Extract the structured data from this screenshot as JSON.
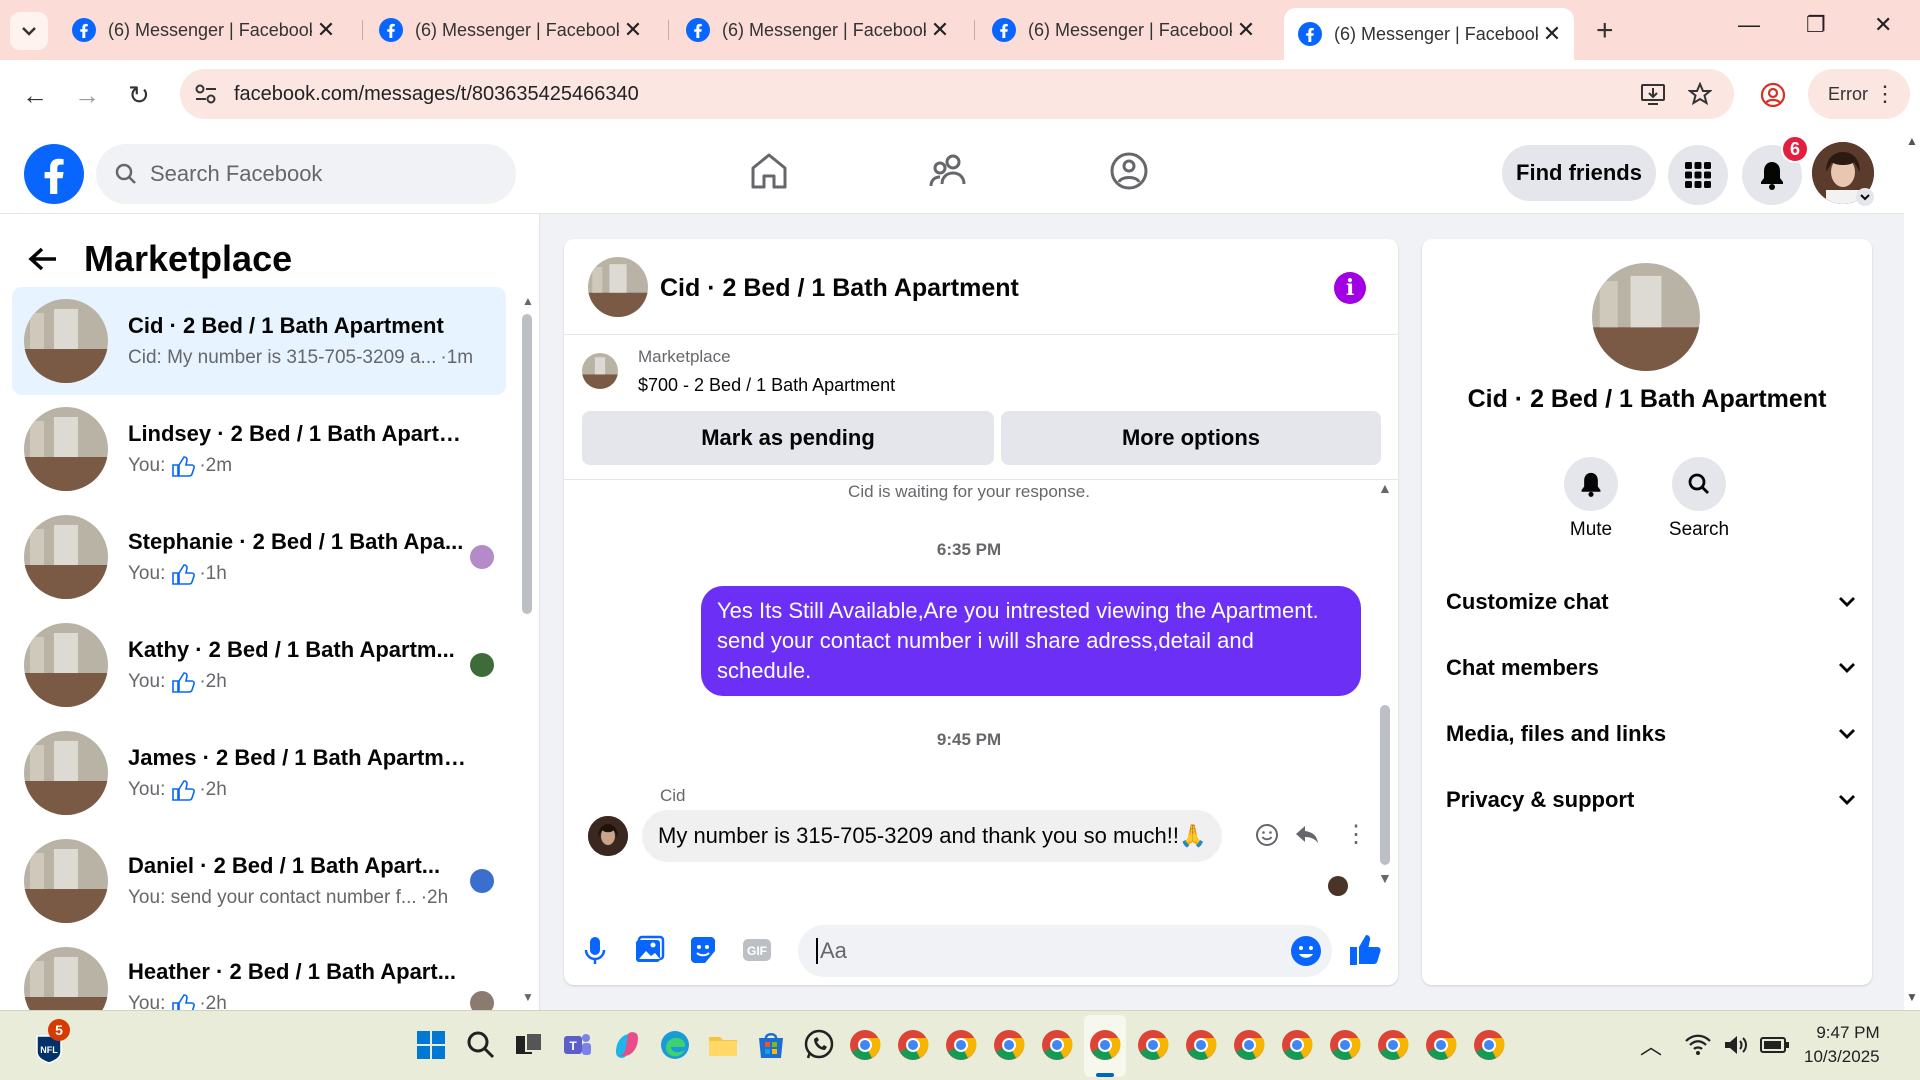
{
  "browser": {
    "tabs": [
      {
        "title": "(6) Messenger | Facebook"
      },
      {
        "title": "(6) Messenger | Facebook"
      },
      {
        "title": "(6) Messenger | Facebook"
      },
      {
        "title": "(6) Messenger | Facebook"
      },
      {
        "title": "(6) Messenger | Facebook"
      }
    ],
    "url": "facebook.com/messages/t/803635425466340",
    "profile_status": "Error"
  },
  "header": {
    "search_placeholder": "Search Facebook",
    "find_friends": "Find friends",
    "notification_count": "6"
  },
  "sidebar": {
    "title": "Marketplace",
    "conversations": [
      {
        "name": "Cid · 2 Bed / 1 Bath Apartment",
        "preview": "Cid: My number is 315-705-3209 a...",
        "time": "·1m"
      },
      {
        "name": "Lindsey · 2 Bed / 1 Bath Apartm...",
        "preview": "You:",
        "time": "·2m"
      },
      {
        "name": "Stephanie · 2 Bed / 1 Bath Apa...",
        "preview": "You:",
        "time": "·1h"
      },
      {
        "name": "Kathy · 2 Bed / 1 Bath Apartm...",
        "preview": "You:",
        "time": "·2h"
      },
      {
        "name": "James · 2 Bed / 1 Bath Apartment",
        "preview": "You:",
        "time": "·2h"
      },
      {
        "name": "Daniel · 2 Bed / 1 Bath Apart...",
        "preview": "You: send your contact number f...",
        "time": "·2h"
      },
      {
        "name": "Heather · 2 Bed / 1 Bath Apart...",
        "preview": "You:",
        "time": "·2h"
      }
    ]
  },
  "chat": {
    "title": "Cid · 2 Bed / 1 Bath Apartment",
    "listing_source": "Marketplace",
    "listing": "$700 - 2 Bed / 1 Bath Apartment",
    "mark_pending": "Mark as pending",
    "more_options": "More options",
    "waiting": "Cid is waiting for your response.",
    "time1": "6:35 PM",
    "outgoing": "Yes Its Still Available,Are you intrested viewing the Apartment. send your contact number i will share adress,detail and schedule.",
    "time2": "9:45 PM",
    "sender": "Cid",
    "incoming": "My number is 315-705-3209 and thank you so much!!🙏",
    "composer_placeholder": "Aa"
  },
  "info_pane": {
    "name": "Cid · 2 Bed / 1 Bath Apartment",
    "mute": "Mute",
    "search": "Search",
    "sections": [
      "Customize chat",
      "Chat members",
      "Media, files and links",
      "Privacy & support"
    ]
  },
  "taskbar": {
    "nfl_badge": "5",
    "time": "9:47 PM",
    "date": "10/3/2025"
  },
  "colors": {
    "facebook_blue": "#0866ff",
    "messenger_purple": "#6b2ff5",
    "tab_strip": "#fbdcd6",
    "notification_red": "#e41e3f"
  }
}
